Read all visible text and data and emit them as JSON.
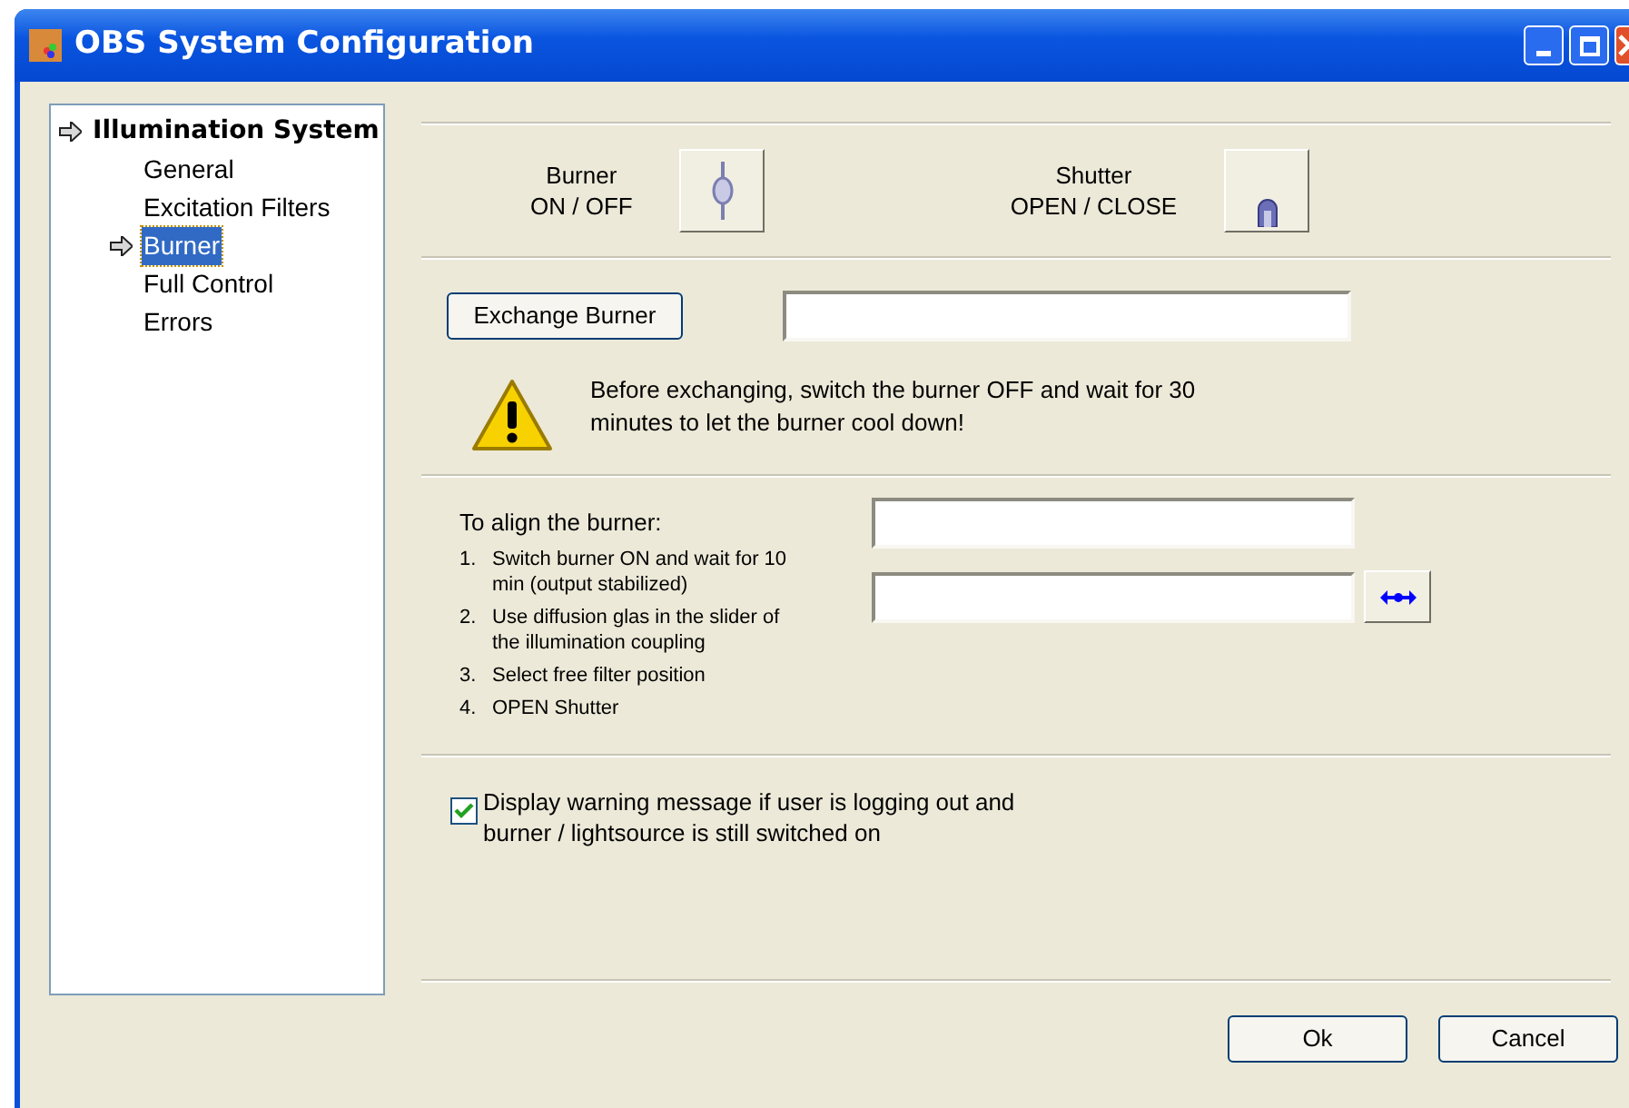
{
  "window": {
    "title": "OBS System Configuration"
  },
  "tree": [
    {
      "label": "Illumination System",
      "expanded": true,
      "selected": false,
      "children": [
        {
          "label": "General",
          "selected": false
        },
        {
          "label": "Excitation Filters",
          "selected": false
        },
        {
          "label": "Burner",
          "selected": true
        },
        {
          "label": "Full Control",
          "selected": false
        },
        {
          "label": "Errors",
          "selected": false
        }
      ]
    }
  ],
  "toggles": [
    {
      "kind": "burner",
      "title": "Burner",
      "subtitle": "ON / OFF"
    },
    {
      "kind": "shutter",
      "title": "Shutter",
      "subtitle": "OPEN / CLOSE"
    }
  ],
  "exchange": {
    "button": "Exchange Burner",
    "warning": "Before exchanging, switch the burner OFF and wait for 30 minutes to let the burner cool down!"
  },
  "align": {
    "heading": "To align the burner:",
    "steps": [
      {
        "number": "1.",
        "text": "Switch burner ON and wait for 10 min (output stabilized)"
      },
      {
        "number": "2.",
        "text": "Use diffusion glas in the slider of the illumination coupling"
      },
      {
        "number": "3.",
        "text": "Select free filter position"
      },
      {
        "number": "4.",
        "text": "OPEN Shutter"
      }
    ]
  },
  "logout_warning": {
    "label": "Display warning message if user is logging out and burner / lightsource is still switched on",
    "checked": true
  },
  "buttons": [
    "Ok",
    "Cancel"
  ]
}
